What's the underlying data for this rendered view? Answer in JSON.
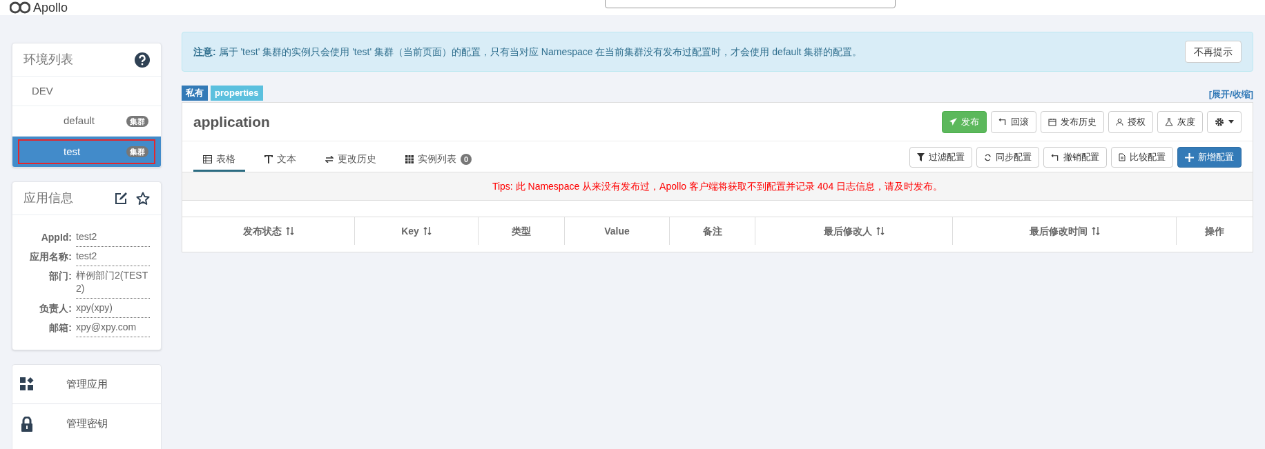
{
  "header": {
    "logo": "Apollo"
  },
  "env_panel": {
    "title": "环境列表",
    "items": [
      {
        "kind": "env",
        "label": "DEV"
      },
      {
        "kind": "cluster",
        "label": "default",
        "badge": "集群",
        "selected": false,
        "outlined": false
      },
      {
        "kind": "cluster",
        "label": "test",
        "badge": "集群",
        "selected": true,
        "outlined": true
      }
    ]
  },
  "app_info": {
    "title": "应用信息",
    "fields": [
      {
        "label": "AppId:",
        "value": "test2"
      },
      {
        "label": "应用名称:",
        "value": "test2"
      },
      {
        "label": "部门:",
        "value": "样例部门2(TEST2)"
      },
      {
        "label": "负责人:",
        "value": "xpy(xpy)"
      },
      {
        "label": "邮箱:",
        "value": "xpy@xpy.com"
      }
    ]
  },
  "nav": [
    {
      "kind": "apps",
      "label": "管理应用"
    },
    {
      "kind": "key",
      "label": "管理密钥"
    }
  ],
  "notice": {
    "text": "**注意:** 属于 'test' 集群的实例只会使用 'test' 集群（当前页面）的配置，只有当对应 Namespace 在当前集群没有发布过配置时，才会使用 default 集群的配置。",
    "button": "不再提示"
  },
  "namespace": {
    "tags": [
      {
        "label": "私有",
        "color": "#337ab7"
      },
      {
        "label": "properties",
        "color": "#5bc0de"
      }
    ],
    "toggle": "[展开/收缩]",
    "name": "application",
    "actions": [
      {
        "kind": "publish",
        "label": "发布"
      },
      {
        "kind": "rollback",
        "label": "回滚"
      },
      {
        "kind": "history",
        "label": "发布历史"
      },
      {
        "kind": "grant",
        "label": "授权"
      },
      {
        "kind": "gray",
        "label": "灰度"
      },
      {
        "kind": "settings"
      }
    ],
    "tabs": [
      {
        "kind": "table",
        "label": "表格",
        "selected": true
      },
      {
        "kind": "text",
        "label": "文本",
        "selected": false
      },
      {
        "kind": "history",
        "label": "更改历史",
        "selected": false
      },
      {
        "kind": "instances",
        "label": "实例列表",
        "badge": "0",
        "selected": false
      }
    ],
    "tools": [
      {
        "kind": "filter",
        "label": "过滤配置"
      },
      {
        "kind": "sync",
        "label": "同步配置"
      },
      {
        "kind": "undo",
        "label": "撤销配置"
      },
      {
        "kind": "compare",
        "label": "比较配置"
      },
      {
        "kind": "add",
        "label": "新增配置"
      }
    ],
    "tips": "Tips: 此 Namespace 从来没有发布过，Apollo 客户端将获取不到配置并记录 404 日志信息，请及时发布。",
    "columns": [
      {
        "label": "发布状态",
        "sortable": true
      },
      {
        "label": "Key",
        "sortable": true
      },
      {
        "label": "类型",
        "sortable": false
      },
      {
        "label": "Value",
        "sortable": false
      },
      {
        "label": "备注",
        "sortable": false
      },
      {
        "label": "最后修改人",
        "sortable": true
      },
      {
        "label": "最后修改时间",
        "sortable": true
      },
      {
        "label": "操作",
        "sortable": false
      }
    ]
  }
}
